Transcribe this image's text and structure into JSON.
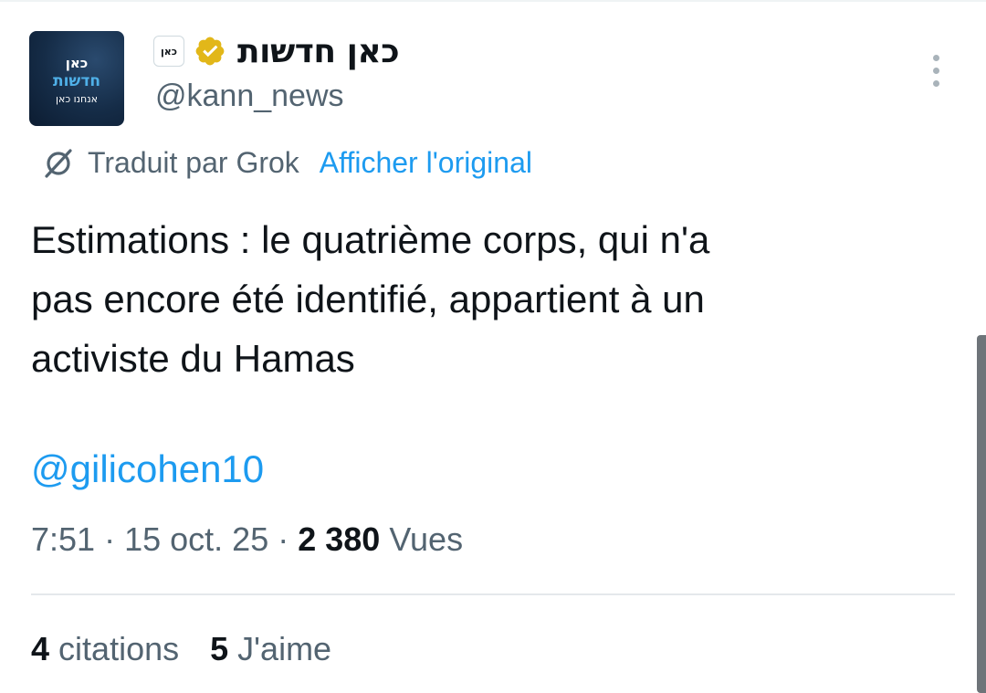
{
  "author": {
    "avatar_lines": [
      "כאן",
      "חדשות",
      "אנחנו כאן"
    ],
    "affiliate_badge": "כאן",
    "display_name": "כאן חדשות",
    "handle": "@kann_news",
    "verified_color": "#e2b719"
  },
  "translation": {
    "translated_by": "Traduit par Grok",
    "show_original": "Afficher l'original"
  },
  "tweet": {
    "text": "Estimations : le quatrième corps, qui n'a\npas encore été identifié, appartient à un\nactiviste du Hamas",
    "mention": "@gilicohen10",
    "time": "7:51",
    "date": "15 oct. 25",
    "views_count": "2 380",
    "views_label": "Vues"
  },
  "engagement": {
    "quotes_count": "4",
    "quotes_label": "citations",
    "likes_count": "5",
    "likes_label": "J'aime"
  },
  "colors": {
    "link": "#1d9bf0",
    "secondary_text": "#536471",
    "primary_text": "#0f1419"
  }
}
